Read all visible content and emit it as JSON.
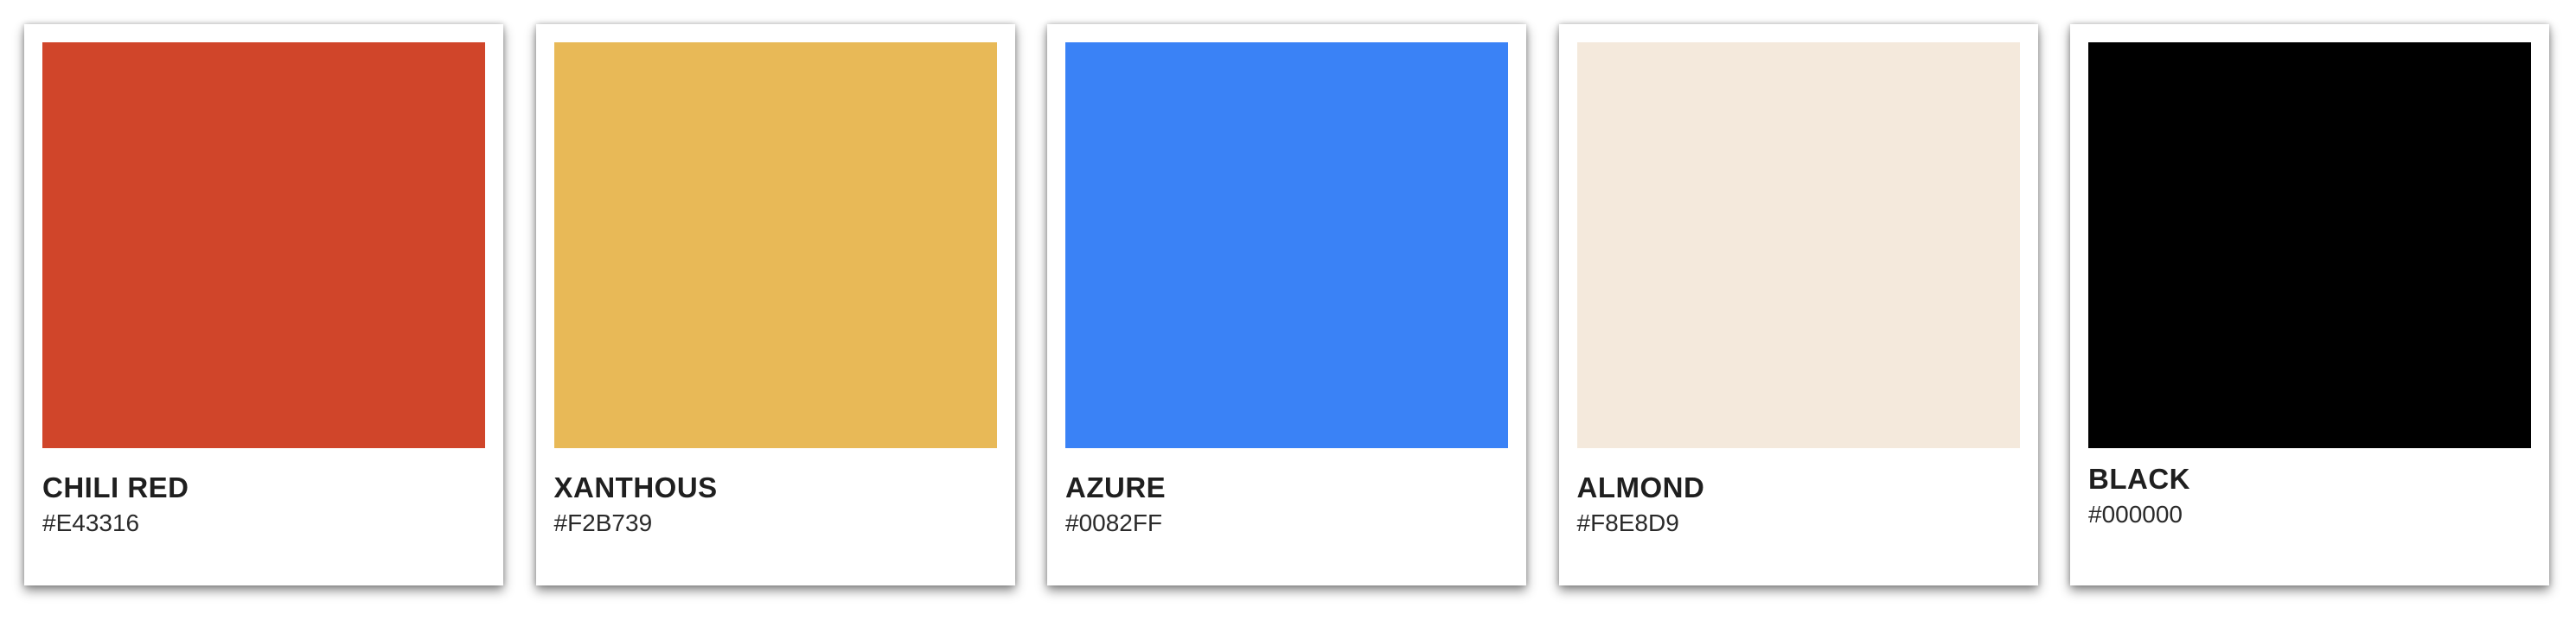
{
  "colors": [
    {
      "name": "CHILI RED",
      "hex": "#E43316",
      "display_color": "#D0452A"
    },
    {
      "name": "XANTHOUS",
      "hex": "#F2B739",
      "display_color": "#E8B957"
    },
    {
      "name": "AZURE",
      "hex": "#0082FF",
      "display_color": "#3A82F6"
    },
    {
      "name": "ALMOND",
      "hex": "#F8E8D9",
      "display_color": "#F4E9DC"
    },
    {
      "name": "BLACK",
      "hex": "#000000",
      "display_color": "#000000"
    }
  ]
}
